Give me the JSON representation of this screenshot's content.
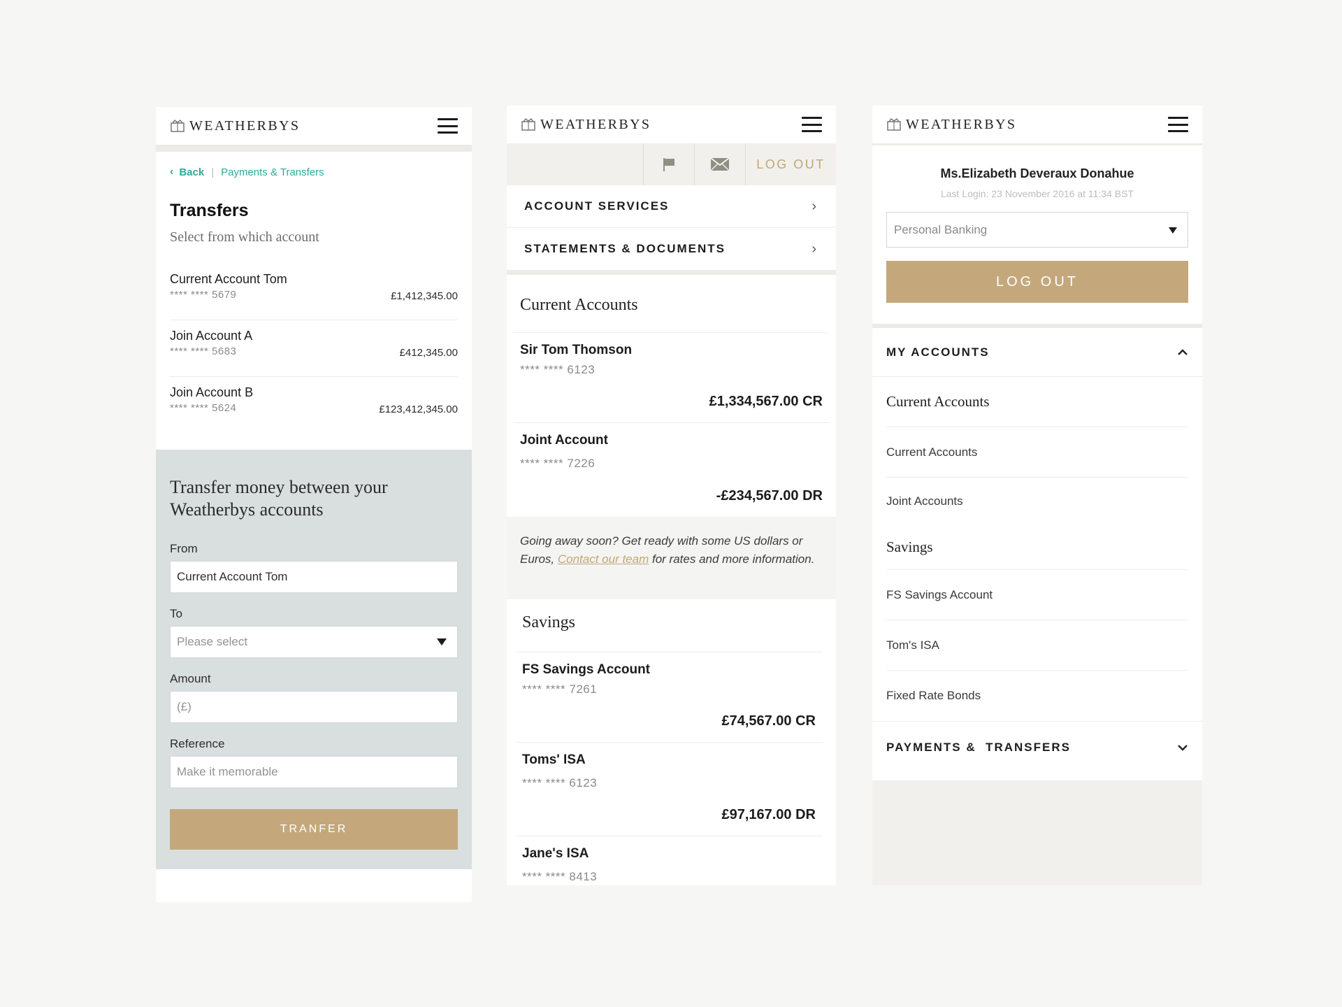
{
  "brand": {
    "logo_text": "WEATHERBYS"
  },
  "transfers_screen": {
    "breadcrumb": {
      "back": "Back",
      "separator": "|",
      "parent": "Payments & Transfers"
    },
    "title": "Transfers",
    "subtitle": "Select from which account",
    "accounts": [
      {
        "name": "Current Account Tom",
        "number": "**** **** 5679",
        "balance": "£1,412,345.00"
      },
      {
        "name": "Join Account A",
        "number": "**** **** 5683",
        "balance": "£412,345.00"
      },
      {
        "name": "Join Account B",
        "number": "**** **** 5624",
        "balance": "£123,412,345.00"
      }
    ],
    "form": {
      "heading": "Transfer money between your Weatherbys accounts",
      "from_label": "From",
      "from_value": "Current Account Tom",
      "to_label": "To",
      "to_placeholder": "Please select",
      "amount_label": "Amount",
      "amount_placeholder": "(£)",
      "reference_label": "Reference",
      "reference_placeholder": "Make it memorable",
      "submit": "TRANFER"
    }
  },
  "accounts_screen": {
    "logout": "LOG OUT",
    "nav": [
      {
        "label": "ACCOUNT SERVICES"
      },
      {
        "label": "STATEMENTS & DOCUMENTS"
      }
    ],
    "current_title": "Current Accounts",
    "current_accounts": [
      {
        "name": "Sir Tom Thomson",
        "number": "****   **** 6123",
        "balance": "£1,334,567.00 CR"
      },
      {
        "name": "Joint Account",
        "number": "**** **** 7226",
        "balance": "-£234,567.00 DR"
      }
    ],
    "promo": {
      "text_before": "Going away soon? Get ready with some US dollars or Euros, ",
      "link": "Contact our team",
      "text_after": " for rates and more information."
    },
    "savings_title": "Savings",
    "savings_accounts": [
      {
        "name": "FS Savings Account",
        "number": "****   **** 7261",
        "balance": "£74,567.00 CR"
      },
      {
        "name": "Toms' ISA",
        "number": "**** **** 6123",
        "balance": "£97,167.00 DR"
      },
      {
        "name": "Jane's ISA",
        "number": "**** **** 8413",
        "balance": ""
      }
    ]
  },
  "menu_screen": {
    "user_name": "Ms.Elizabeth Deveraux Donahue",
    "last_login": "Last Login: 23 November 2016 at 11:34 BST",
    "banking_select": "Personal Banking",
    "logout": "LOG OUT",
    "my_accounts": "MY ACCOUNTS",
    "current_category": "Current Accounts",
    "current_items": [
      "Current Accounts",
      "Joint Accounts"
    ],
    "savings_category": "Savings",
    "savings_items": [
      "FS Savings Account",
      "Tom's ISA",
      "Fixed Rate Bonds"
    ],
    "payments": "PAYMENTS &  TRANSFERS"
  },
  "colors": {
    "gold": "#c4a87c",
    "teal": "#33a89b",
    "form_bg": "#d9dfde"
  }
}
